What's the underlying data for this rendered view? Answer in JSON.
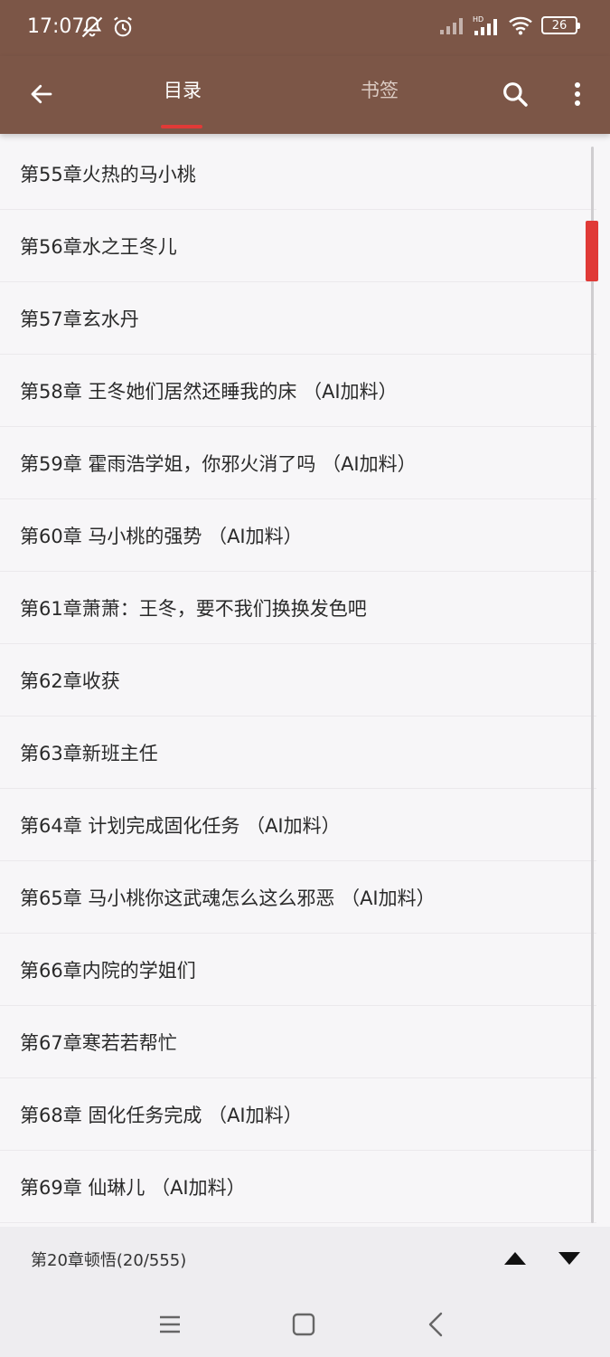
{
  "status_bar": {
    "time": "17:07",
    "battery": "26",
    "icons": [
      "notifications-off-icon",
      "alarm-icon",
      "cellular-signal-icon",
      "hd-signal-icon",
      "wifi-icon",
      "battery-icon"
    ]
  },
  "toolbar": {
    "tabs": [
      {
        "label": "目录",
        "active": true
      },
      {
        "label": "书签",
        "active": false
      }
    ],
    "icons": [
      "back-arrow-icon",
      "search-icon",
      "more-vert-icon"
    ],
    "accent_color": "#e03a37",
    "bar_color": "#7c5647"
  },
  "chapters": [
    "第55章火热的马小桃",
    "第56章水之王冬儿",
    "第57章玄水丹",
    "第58章 王冬她们居然还睡我的床 （AI加料）",
    "第59章 霍雨浩学姐，你邪火消了吗 （AI加料）",
    "第60章 马小桃的强势 （AI加料）",
    "第61章萧萧：王冬，要不我们换换发色吧",
    "第62章收获",
    "第63章新班主任",
    "第64章 计划完成固化任务 （AI加料）",
    "第65章 马小桃你这武魂怎么这么邪恶 （AI加料）",
    "第66章内院的学姐们",
    "第67章寒若若帮忙",
    "第68章 固化任务完成 （AI加料）",
    "第69章 仙琳儿 （AI加料）"
  ],
  "bottom_bar": {
    "current_chapter": "第20章顿悟(20/555)",
    "icons": [
      "arrow-up-icon",
      "arrow-down-icon"
    ]
  },
  "nav_bar": {
    "icons": [
      "menu-icon",
      "home-icon",
      "back-icon"
    ]
  }
}
